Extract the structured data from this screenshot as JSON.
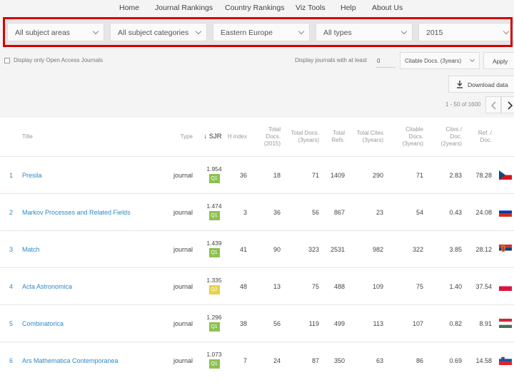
{
  "nav": {
    "items": [
      "Home",
      "Journal Rankings",
      "Country Rankings",
      "Viz Tools",
      "Help",
      "About Us"
    ]
  },
  "filters": {
    "subject_areas": "All subject areas",
    "subject_categories": "All subject categories",
    "region": "Eastern Europe",
    "types": "All types",
    "year": "2015"
  },
  "options": {
    "open_access_label": "Display only Open Access Journals",
    "min_label": "Display journals with at least",
    "min_value": "0",
    "citable_select": "Citable Docs. (3years)",
    "apply_label": "Apply",
    "download_label": "Download data",
    "pager_info": "1 - 50 of 1600"
  },
  "table": {
    "headers": {
      "title": "Title",
      "type": "Type",
      "sjr": "↓ SJR",
      "h_index": "H index",
      "total_docs_year": "Total Docs. (2015)",
      "total_docs_3y": "Total Docs. (3years)",
      "total_refs": "Total Refs.",
      "total_cites": "Total Cites (3years)",
      "citable_docs": "Citable Docs. (3years)",
      "cites_per_doc": "Cites / Doc. (2years)",
      "ref_per_doc": "Ref. / Doc."
    },
    "rows": [
      {
        "rank": "1",
        "title": "Presila",
        "type": "journal",
        "sjr": "1.954",
        "quartile": "Q1",
        "h_index": "36",
        "docs_year": "18",
        "docs_3y": "71",
        "refs": "1409",
        "cites": "290",
        "citable": "71",
        "cites_doc": "2.83",
        "ref_doc": "78.28",
        "country_flag": "czech-republic-flag"
      },
      {
        "rank": "2",
        "title": "Markov Processes and Related Fields",
        "type": "journal",
        "sjr": "1.474",
        "quartile": "Q1",
        "h_index": "3",
        "docs_year": "36",
        "docs_3y": "56",
        "refs": "867",
        "cites": "23",
        "citable": "54",
        "cites_doc": "0.43",
        "ref_doc": "24.08",
        "country_flag": "russia-flag"
      },
      {
        "rank": "3",
        "title": "Match",
        "type": "journal",
        "sjr": "1.439",
        "quartile": "Q1",
        "h_index": "41",
        "docs_year": "90",
        "docs_3y": "323",
        "refs": "2531",
        "cites": "982",
        "citable": "322",
        "cites_doc": "3.85",
        "ref_doc": "28.12",
        "country_flag": "serbia-flag"
      },
      {
        "rank": "4",
        "title": "Acta Astronomica",
        "type": "journal",
        "sjr": "1.335",
        "quartile": "Q2",
        "h_index": "48",
        "docs_year": "13",
        "docs_3y": "75",
        "refs": "488",
        "cites": "109",
        "citable": "75",
        "cites_doc": "1.40",
        "ref_doc": "37.54",
        "country_flag": "poland-flag"
      },
      {
        "rank": "5",
        "title": "Combinatorica",
        "type": "journal",
        "sjr": "1.296",
        "quartile": "Q1",
        "h_index": "38",
        "docs_year": "56",
        "docs_3y": "119",
        "refs": "499",
        "cites": "113",
        "citable": "107",
        "cites_doc": "0.82",
        "ref_doc": "8.91",
        "country_flag": "hungary-flag"
      },
      {
        "rank": "6",
        "title": "Ars Mathematica Contemporanea",
        "type": "journal",
        "sjr": "1.073",
        "quartile": "Q1",
        "h_index": "7",
        "docs_year": "24",
        "docs_3y": "87",
        "refs": "350",
        "cites": "63",
        "citable": "86",
        "cites_doc": "0.69",
        "ref_doc": "14.58",
        "country_flag": "slovenia-flag"
      }
    ]
  },
  "colors": {
    "highlight_outline": "#d60000",
    "link": "#2d8ac7",
    "q1": "#8cc152",
    "q2": "#e8d04a"
  }
}
